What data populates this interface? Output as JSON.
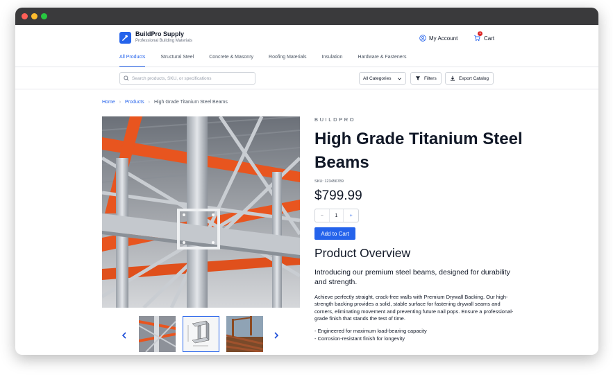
{
  "brand": {
    "name": "BuildPro Supply",
    "tagline": "Professional Building Materials"
  },
  "header": {
    "account_label": "My Account",
    "cart_label": "Cart",
    "cart_count": "1"
  },
  "nav": {
    "tabs": [
      {
        "label": "All Products",
        "active": true
      },
      {
        "label": "Structural Steel"
      },
      {
        "label": "Concrete & Masonry"
      },
      {
        "label": "Roofing Materials"
      },
      {
        "label": "Insulation"
      },
      {
        "label": "Hardware & Fasteners"
      }
    ]
  },
  "toolbar": {
    "search_placeholder": "Search products, SKU, or specifications",
    "category_value": "All Categories",
    "filters_label": "Filters",
    "export_label": "Export Catalog"
  },
  "breadcrumb": {
    "home": "Home",
    "products": "Products",
    "current": "High Grade Titanium Steel Beams"
  },
  "product": {
    "brand": "BUILDPRO",
    "title": "High Grade Titanium Steel Beams",
    "sku": "SKU: 123456789",
    "price": "$799.99",
    "quantity": "1",
    "qty_minus": "−",
    "qty_plus": "+",
    "add_to_cart": "Add to Cart",
    "overview_title": "Product Overview",
    "intro": "Introducing our premium steel beams, designed for durability and strength.",
    "description": "Achieve perfectly straight, crack-free walls with Premium Drywall Backing. Our high-strength backing provides a solid, stable surface for fastening drywall seams and corners, eliminating movement and preventing future nail pops. Ensure a professional-grade finish that stands the test of time.",
    "features": [
      "- Engineered for maximum load-bearing capacity",
      "- Corrosion-resistant finish for longevity"
    ]
  },
  "colors": {
    "accent": "#2563eb",
    "badge": "#dc2626",
    "beam_orange": "#e8551f",
    "steel": "#b8bcc2"
  },
  "icons": [
    "hammer-logo-icon",
    "user-circle-icon",
    "cart-icon",
    "search-icon",
    "chevron-down-icon",
    "filter-icon",
    "download-icon",
    "chevron-right-icon",
    "chevron-left-icon"
  ]
}
